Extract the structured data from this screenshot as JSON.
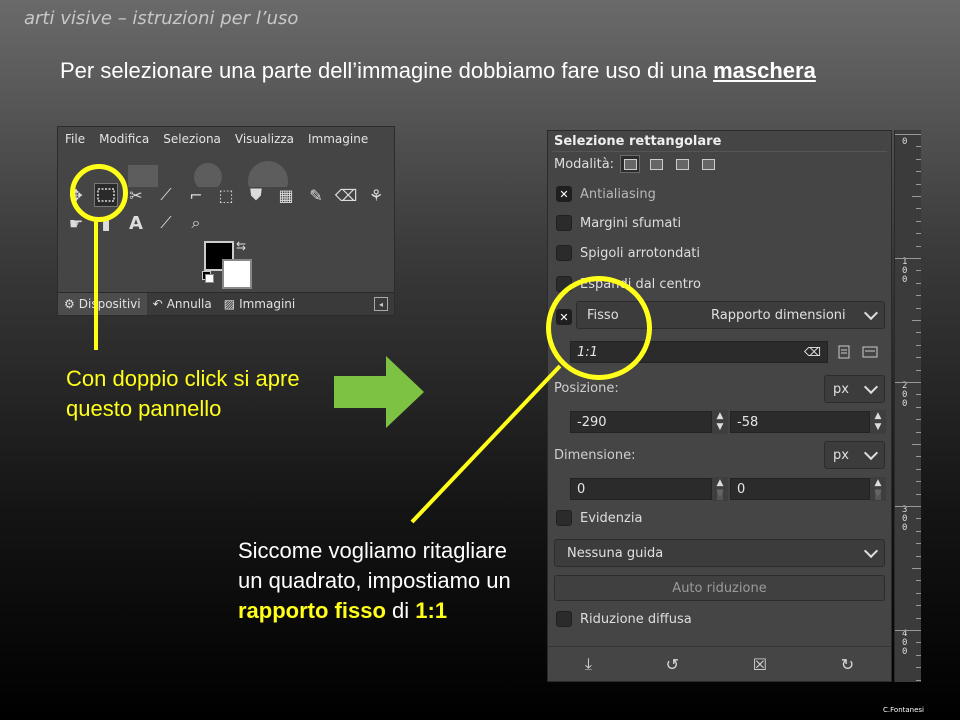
{
  "slide": {
    "title": "arti visive – istruzioni per l’uso",
    "intro_text": "Per selezionare una parte dell’immagine dobbiamo fare uso di una ",
    "intro_bold": "maschera",
    "credit": "C.Fontanesi"
  },
  "toolbox": {
    "menu": [
      "File",
      "Modifica",
      "Seleziona",
      "Visualizza",
      "Immagine"
    ],
    "row1_icons": [
      "move-icon",
      "rect-select-icon",
      "free-select-icon",
      "measure-icon",
      "crop-icon",
      "transform-icon",
      "bucket-fill-icon",
      "blend-icon",
      "pencil-icon",
      "eraser-icon",
      "clone-icon"
    ],
    "row2_icons": [
      "smudge-icon",
      "paths-icon",
      "text-icon",
      "color-picker-icon",
      "zoom-icon"
    ],
    "tabs": [
      "Dispositivi",
      "Annulla",
      "Immagini"
    ]
  },
  "captions": {
    "left": "Con doppio click si apre questo pannello",
    "bottom_text": "Siccome vogliamo ritagliare un quadrato, impostiamo un ",
    "bottom_hl1": "rapporto fisso",
    "bottom_mid": " di ",
    "bottom_hl2": "1:1"
  },
  "panel": {
    "title": "Selezione rettangolare",
    "mode_label": "Modalità:",
    "antialiasing": "Antialiasing",
    "feather": "Margini sfumati",
    "rounded": "Spigoli arrotondati",
    "expand": "Espandi dal centro",
    "fixed": "Fisso",
    "fixed_option": "Rapporto dimensioni",
    "ratio_value": "1:1",
    "position_label": "Posizione:",
    "position_unit": "px",
    "pos_x": "-290",
    "pos_y": "-58",
    "size_label": "Dimensione:",
    "size_unit": "px",
    "size_w": "0",
    "size_h": "0",
    "highlight": "Evidenzia",
    "guides": "Nessuna guida",
    "auto_shrink": "Auto riduzione",
    "shrink_merged": "Riduzione diffusa"
  },
  "ruler": [
    "0",
    "100",
    "200",
    "300",
    "400"
  ],
  "colors": {
    "highlight": "#ffff1a",
    "arrow": "#7dc242"
  }
}
